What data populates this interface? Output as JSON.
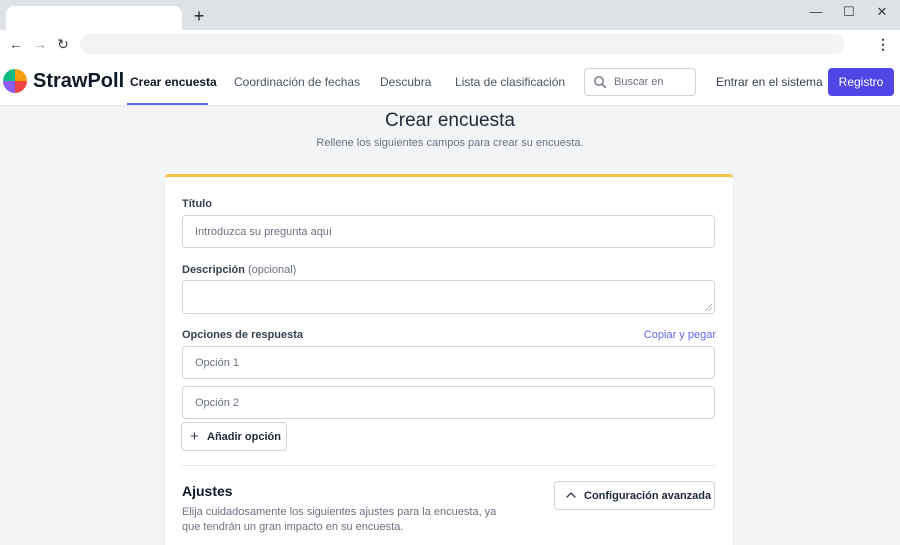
{
  "browser": {
    "new_tab_glyph": "+",
    "back_glyph": "←",
    "forward_glyph": "→",
    "reload_glyph": "↻",
    "menu_glyph": "⋮",
    "minimize_glyph": "—",
    "maximize_glyph": "☐",
    "close_glyph": "✕"
  },
  "header": {
    "logo": "StrawPoll",
    "nav": [
      {
        "label": "Crear encuesta",
        "active": true
      },
      {
        "label": "Coordinación de fechas",
        "active": false
      },
      {
        "label": "Descubra",
        "active": false
      },
      {
        "label": "Lista de clasificación",
        "active": false
      }
    ],
    "search_placeholder": "Buscar en",
    "login": "Entrar en el sistema",
    "register": "Registro",
    "accent_color": "#4f46e5"
  },
  "page": {
    "title": "Crear encuesta",
    "subtitle": "Rellene los siguientes campos para crear su encuesta."
  },
  "form": {
    "title_label": "Título",
    "title_placeholder": "Introduzca su pregunta aquí",
    "description_label": "Descripción",
    "description_optional": "(opcional)",
    "options_label": "Opciones de respuesta",
    "copy_paste": "Copiar y pegar",
    "options": [
      {
        "placeholder": "Opción 1"
      },
      {
        "placeholder": "Opción 2"
      }
    ],
    "add_option": "Añadir opción",
    "add_glyph": "+"
  },
  "settings": {
    "title": "Ajustes",
    "description": "Elija cuidadosamente los siguientes ajustes para la encuesta, ya que tendrán un gran impacto en su encuesta.",
    "advanced": "Configuración avanzada"
  }
}
